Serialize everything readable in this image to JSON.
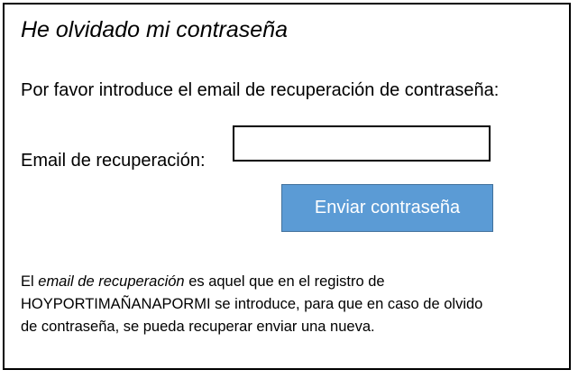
{
  "dialog": {
    "title": "He olvidado mi contraseña",
    "instructions": "Por favor introduce el email de recuperación de contraseña:",
    "email_label": "Email de recuperación:",
    "email_value": "",
    "submit_label": "Enviar contraseña"
  },
  "note": {
    "prefix": "El ",
    "emphasis": "email de recuperación",
    "line1_rest": " es aquel que en el registro de",
    "line2": "HOYPORTIMAÑANAPORMI se introduce, para que en caso de olvido",
    "line3": "de contraseña, se pueda recuperar enviar una nueva."
  },
  "colors": {
    "button_fill": "#5b9bd5",
    "button_border": "#41719c",
    "button_text": "#ffffff",
    "frame_border": "#000000"
  }
}
